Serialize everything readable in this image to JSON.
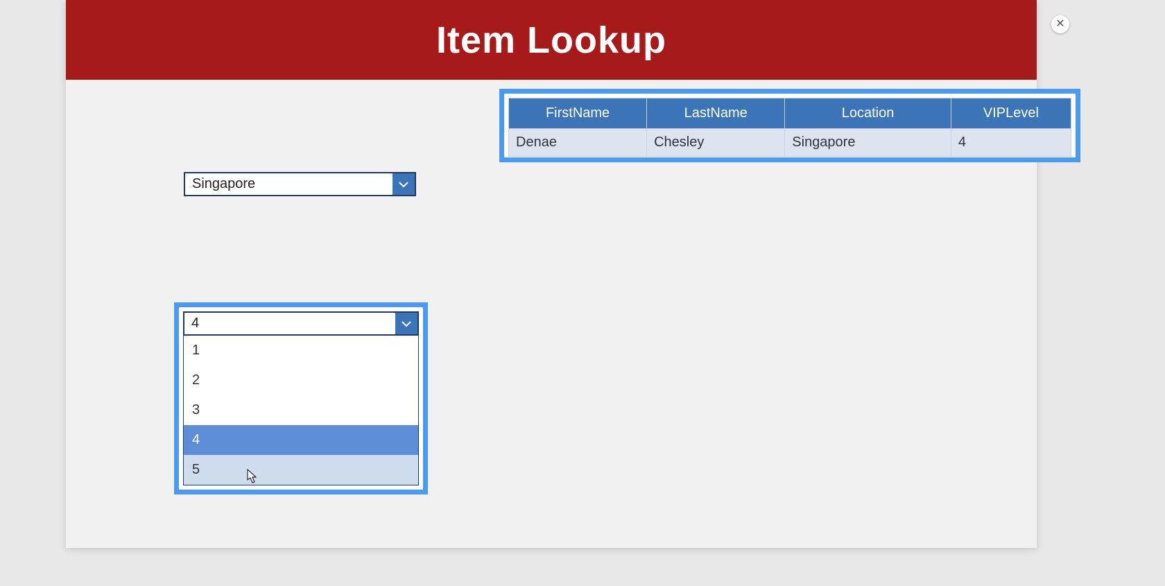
{
  "header": {
    "title": "Item Lookup"
  },
  "table": {
    "columns": [
      "FirstName",
      "LastName",
      "Location",
      "VIPLevel"
    ],
    "rows": [
      {
        "c0": "Denae",
        "c1": "Chesley",
        "c2": "Singapore",
        "c3": "4"
      }
    ]
  },
  "location_combo": {
    "value": "Singapore"
  },
  "vip_combo": {
    "value": "4",
    "options": [
      "1",
      "2",
      "3",
      "4",
      "5"
    ],
    "selected_index": 3,
    "hover_index": 4
  }
}
